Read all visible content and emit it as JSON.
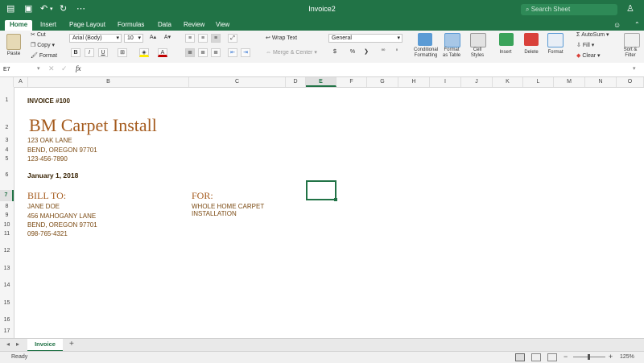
{
  "window": {
    "title": "Invoice2",
    "search_placeholder": "Search Sheet"
  },
  "ribbon_tabs": [
    "Home",
    "Insert",
    "Page Layout",
    "Formulas",
    "Data",
    "Review",
    "View"
  ],
  "clipboard": {
    "paste": "Paste",
    "cut": "Cut",
    "copy": "Copy",
    "format": "Format"
  },
  "font": {
    "name": "Arial (Body)",
    "size": "10",
    "bold": "B",
    "italic": "I",
    "underline": "U"
  },
  "alignment": {
    "wrap_text": "Wrap Text",
    "merge": "Merge & Center"
  },
  "number": {
    "format": "General",
    "currency": "$",
    "percent": "%",
    "comma": "❯"
  },
  "styles": {
    "conditional": "Conditional\nFormatting",
    "format_table": "Format\nas Table",
    "cell_styles": "Cell\nStyles"
  },
  "cells_group": {
    "insert": "Insert",
    "delete": "Delete",
    "format": "Format"
  },
  "editing": {
    "autosum": "AutoSum",
    "fill": "Fill",
    "clear": "Clear",
    "sort": "Sort &\nFilter"
  },
  "formula_bar": {
    "name_box": "E7",
    "fx": "fx",
    "value": ""
  },
  "columns": [
    "A",
    "B",
    "C",
    "D",
    "E",
    "F",
    "G",
    "H",
    "I",
    "J",
    "K",
    "L",
    "M",
    "N",
    "O"
  ],
  "rows": [
    "1",
    "2",
    "3",
    "4",
    "5",
    "6",
    "7",
    "8",
    "9",
    "10",
    "11",
    "12",
    "13",
    "14",
    "15",
    "16",
    "17"
  ],
  "selected_cell": {
    "col": "E",
    "row": "7"
  },
  "sheet": {
    "invoice_no": "INVOICE #100",
    "company": "BM Carpet Install",
    "address1": "123 OAK LANE",
    "address2": "BEND, OREGON 97701",
    "phone": "123-456-7890",
    "date": "January 1, 2018",
    "bill_to_label": "BILL TO:",
    "bill_name": "JANE DOE",
    "bill_addr1": "456 MAHOGANY LANE",
    "bill_addr2": "BEND, OREGON 97701",
    "bill_phone": "098-765-4321",
    "for_label": "FOR:",
    "for_line1": "WHOLE HOME CARPET",
    "for_line2": "INSTALLATION"
  },
  "sheet_tabs": [
    "Invoice"
  ],
  "status": {
    "ready": "Ready",
    "zoom": "125%"
  },
  "colors": {
    "excel_green": "#217346",
    "brown_text": "#7b4a12"
  }
}
